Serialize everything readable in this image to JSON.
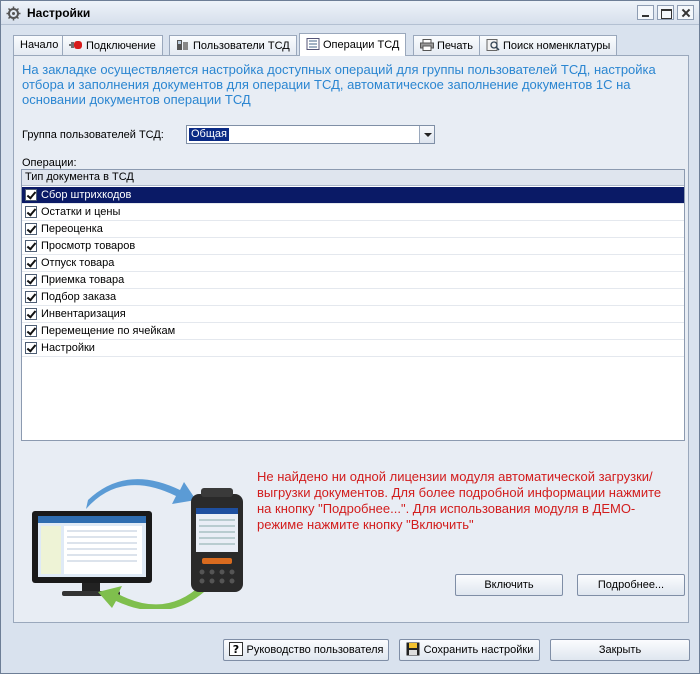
{
  "window": {
    "title": "Настройки"
  },
  "tabs": [
    {
      "label": "Начало",
      "icon": "none"
    },
    {
      "label": "Подключение",
      "icon": "plug-icon"
    },
    {
      "label": "Пользователи ТСД",
      "icon": "users-icon"
    },
    {
      "label": "Операции ТСД",
      "icon": "list-icon",
      "active": true
    },
    {
      "label": "Печать",
      "icon": "printer-icon"
    },
    {
      "label": "Поиск номенклатуры",
      "icon": "search-icon"
    }
  ],
  "info_text": "На закладке осуществляется настройка доступных операций для группы пользователей ТСД, настройка отбора  и  заполнения  документов  для операции ТСД, автоматическое заполнение документов  1С на основании документов  операции ТСД",
  "group": {
    "label": "Группа пользователей ТСД:",
    "value": "Общая"
  },
  "operations": {
    "label": "Операции:",
    "column_header": "Тип документа в ТСД",
    "rows": [
      {
        "label": "Сбор штрихкодов",
        "checked": true,
        "selected": true
      },
      {
        "label": "Остатки и цены",
        "checked": true
      },
      {
        "label": "Переоценка",
        "checked": true
      },
      {
        "label": "Просмотр товаров",
        "checked": true
      },
      {
        "label": "Отпуск товара",
        "checked": true
      },
      {
        "label": "Приемка товара",
        "checked": true
      },
      {
        "label": "Подбор заказа",
        "checked": true
      },
      {
        "label": "Инвентаризация",
        "checked": true
      },
      {
        "label": "Перемещение по ячейкам",
        "checked": true
      },
      {
        "label": "Настройки",
        "checked": true
      }
    ]
  },
  "license_warning": "Не найдено ни одной лицензии модуля автоматической загрузки/выгрузки документов. Для более подробной информации нажмите на кнопку \"Подробнее...\". Для использования модуля в ДЕМО-режиме нажмите кнопку \"Включить\"",
  "buttons": {
    "enable": "Включить",
    "more": "Подробнее...",
    "guide": "Руководство пользователя",
    "save": "Сохранить настройки",
    "close": "Закрыть"
  },
  "colors": {
    "info_text": "#2b86d1",
    "warning_text": "#d21d1d",
    "selection": "#0a1a66"
  }
}
